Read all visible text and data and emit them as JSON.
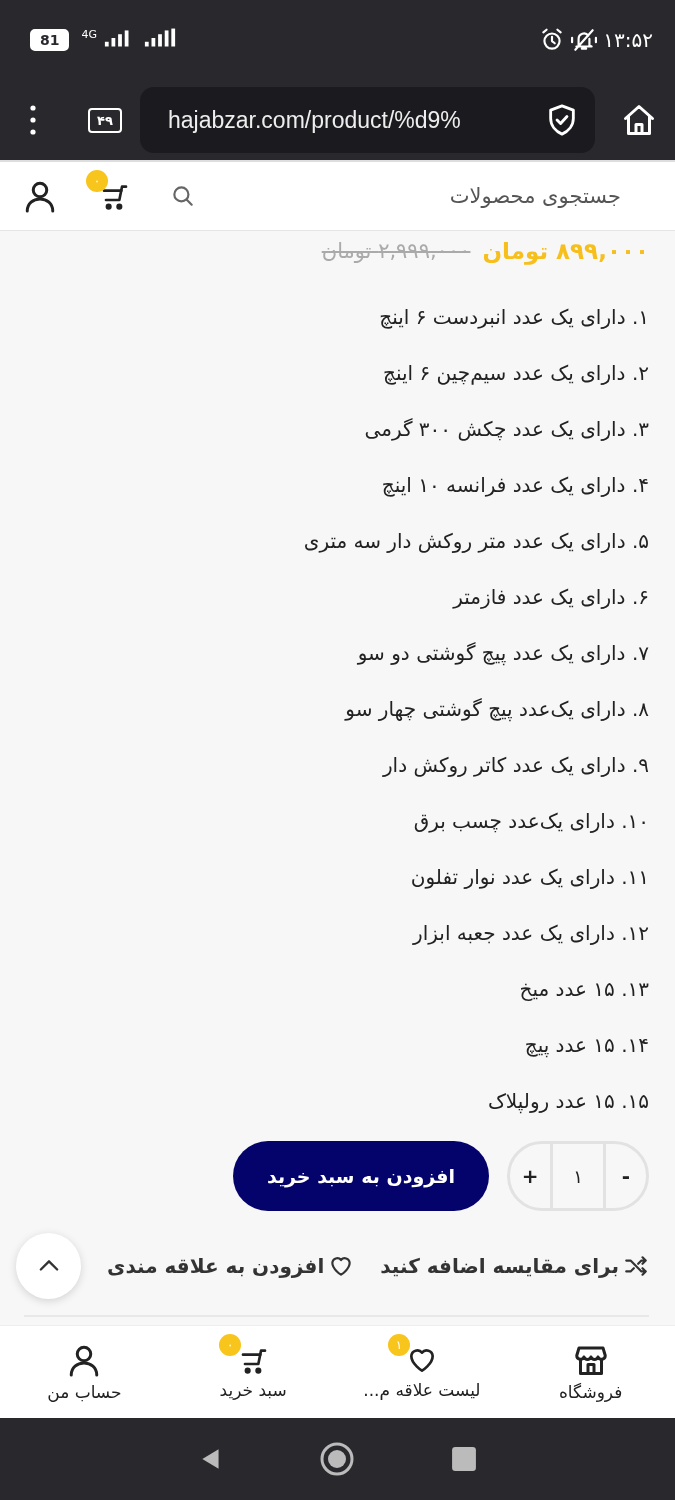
{
  "status_bar": {
    "battery": "81",
    "network": "4G",
    "time": "۱۳:۵۲"
  },
  "browser": {
    "url": "hajabzar.com/product/%d9%",
    "tab_count": "۴۹"
  },
  "header": {
    "search": {
      "placeholder": "جستجوی محصولات"
    },
    "cart_count": "۰"
  },
  "price": {
    "old": "۲,۹۹۹,۰۰۰ تومان",
    "new": "۸۹۹,۰۰۰ تومان"
  },
  "features": [
    "۱. دارای یک عدد انبردست ۶ اینچ",
    "۲. دارای یک عدد سیم‌چین ۶ اینچ",
    "۳. دارای یک عدد چکش ۳۰۰ گرمی",
    "۴. دارای یک عدد فرانسه ۱۰ اینچ",
    "۵. دارای یک عدد متر روکش دار سه متری",
    "۶. دارای یک عدد فازمتر",
    "۷. دارای یک عدد پیچ گوشتی دو سو",
    "۸. دارای یک‌عدد پیچ گوشتی چهار سو",
    "۹. دارای یک عدد کاتر روکش دار",
    "۱۰. دارای یک‌عدد چسب برق",
    "۱۱. دارای یک عدد نوار تفلون",
    "۱۲. دارای یک عدد جعبه ابزار",
    "۱۳. ۱۵ عدد میخ",
    "۱۴. ۱۵ عدد پیچ",
    "۱۵. ۱۵ عدد رولپلاک"
  ],
  "quantity": {
    "minus": "-",
    "value": "۱",
    "plus": "+"
  },
  "add_to_cart": "افزودن به سبد خرید",
  "compare": "برای مقایسه اضافه کنید",
  "wishlist": "افزودن به علاقه مندی",
  "bottom_nav": [
    {
      "kind": "store",
      "label": "فروشگاه"
    },
    {
      "kind": "wishlist",
      "label": "لیست علاقه م...",
      "badge": "۱"
    },
    {
      "kind": "cart",
      "label": "سبد خرید",
      "badge": "۰"
    },
    {
      "kind": "account",
      "label": "حساب من"
    }
  ]
}
